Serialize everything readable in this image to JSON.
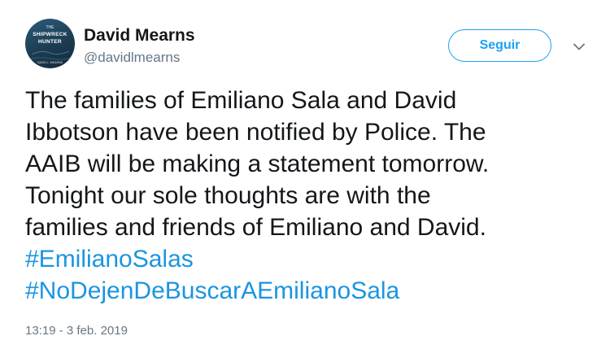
{
  "author": {
    "name": "David Mearns",
    "handle": "@davidlmearns",
    "avatar_text": {
      "line1": "THE",
      "line2": "SHIPWRECK",
      "line3": "HUNTER",
      "line4": "DAVID L. MEARNS"
    }
  },
  "actions": {
    "follow_label": "Seguir",
    "menu_icon": "chevron-down-icon"
  },
  "tweet": {
    "lines": [
      "The families of Emiliano Sala and David",
      "Ibbotson have been notified by Police. The",
      "AAIB will be making a statement tomorrow.",
      "Tonight our sole thoughts are with the",
      "families and friends of Emiliano and David."
    ],
    "hashtags": [
      "#EmilianoSalas",
      "#NoDejenDeBuscarAEmilianoSala"
    ]
  },
  "timestamp": "13:19 - 3 feb. 2019",
  "colors": {
    "accent": "#1da1f2",
    "hashtag": "#1b95e0",
    "text": "#14171a",
    "muted": "#657786"
  }
}
